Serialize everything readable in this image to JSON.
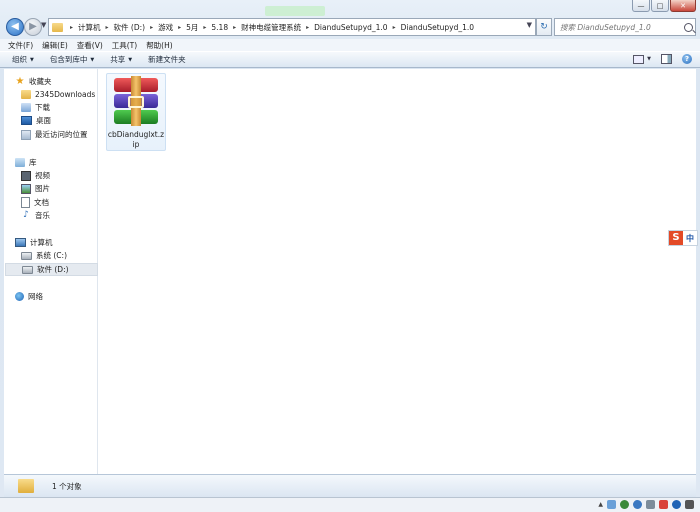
{
  "window": {
    "minimize_glyph": "—",
    "maximize_glyph": "□",
    "close_glyph": "✕"
  },
  "address": {
    "back_glyph": "◀",
    "forward_glyph": "▶",
    "breadcrumbs": [
      "计算机",
      "软件 (D:)",
      "游戏",
      "5月",
      "5.18",
      "财神电缆管理系统",
      "DianduSetupyd_1.0",
      "DianduSetupyd_1.0"
    ],
    "refresh_glyph": "↻",
    "search_placeholder": "搜索 DianduSetupyd_1.0"
  },
  "menu": [
    "文件(F)",
    "编辑(E)",
    "查看(V)",
    "工具(T)",
    "帮助(H)"
  ],
  "commands": {
    "organize": "组织",
    "include_library": "包含到库中",
    "share": "共享",
    "new_folder": "新建文件夹"
  },
  "navigation": {
    "favorites": {
      "label": "收藏夹",
      "items": [
        "2345Downloads",
        "下载",
        "桌面",
        "最近访问的位置"
      ]
    },
    "libraries": {
      "label": "库",
      "items": [
        "视频",
        "图片",
        "文档",
        "音乐"
      ]
    },
    "computer": {
      "label": "计算机",
      "items": [
        "系统 (C:)",
        "软件 (D:)"
      ],
      "selected": "软件 (D:)"
    },
    "network": {
      "label": "网络"
    }
  },
  "files": [
    {
      "name": "cbDianduglxt.zip",
      "type": "zip-archive",
      "selected": true
    }
  ],
  "ime": {
    "logo": "S",
    "mode": "中"
  },
  "status": {
    "count_text": "1 个对象"
  },
  "colors": {
    "zip_red": "#d32f3a",
    "zip_purple": "#5a45c0",
    "zip_green": "#2fa33a",
    "accent_blue": "#2c72c7"
  }
}
